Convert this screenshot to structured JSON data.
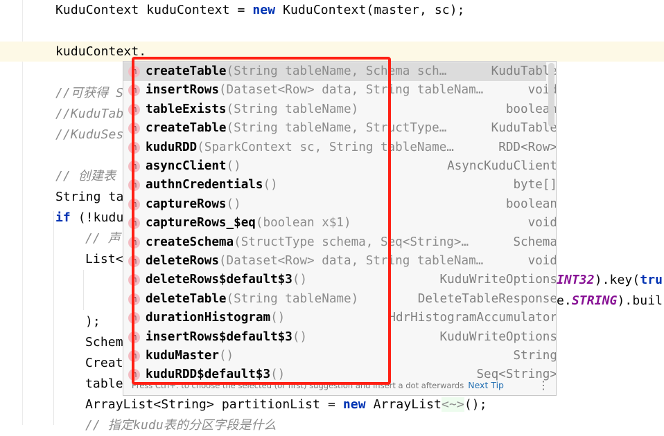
{
  "editor": {
    "lines": [
      {
        "indent": 0,
        "parts": [
          [
            "KuduContext kuduContext = ",
            ""
          ],
          [
            "new",
            "kw"
          ],
          [
            " KuduContext(master, sc);",
            ""
          ]
        ]
      },
      {
        "indent": 0,
        "parts": []
      },
      {
        "indent": 0,
        "parts": [
          [
            "kuduContext.",
            ""
          ]
        ]
      },
      {
        "indent": 0,
        "parts": []
      },
      {
        "indent": 0,
        "parts": [
          [
            "//可获得 S",
            "cm"
          ]
        ]
      },
      {
        "indent": 0,
        "parts": [
          [
            "//KuduTab",
            "cm"
          ]
        ]
      },
      {
        "indent": 0,
        "parts": [
          [
            "//KuduSes",
            "cm"
          ]
        ]
      },
      {
        "indent": 0,
        "parts": []
      },
      {
        "indent": 0,
        "parts": [
          [
            "// 创建表",
            "cm"
          ]
        ]
      },
      {
        "indent": 0,
        "parts": [
          [
            "String ta",
            ""
          ]
        ]
      },
      {
        "indent": 0,
        "parts": [
          [
            "if",
            "kw"
          ],
          [
            " (!kudu",
            ""
          ]
        ]
      },
      {
        "indent": 1,
        "parts": [
          [
            "// 声",
            "cm"
          ]
        ]
      },
      {
        "indent": 1,
        "parts": [
          [
            "List<",
            ""
          ]
        ]
      },
      {
        "indent": 2,
        "parts": []
      },
      {
        "indent": 2,
        "parts": []
      },
      {
        "indent": 1,
        "parts": [
          [
            ");",
            ""
          ]
        ]
      },
      {
        "indent": 1,
        "parts": [
          [
            "Schem",
            ""
          ]
        ]
      },
      {
        "indent": 1,
        "parts": [
          [
            "Creat",
            ""
          ]
        ]
      },
      {
        "indent": 1,
        "parts": [
          [
            "table",
            ""
          ]
        ]
      },
      {
        "indent": 1,
        "parts": [
          [
            "ArrayList<String> partitionList = ",
            ""
          ],
          [
            "new",
            "kw"
          ],
          [
            " ArrayList",
            ""
          ],
          [
            "<~>",
            "diamond"
          ],
          [
            "();",
            ""
          ]
        ]
      },
      {
        "indent": 1,
        "parts": [
          [
            "// 指定kudu表的分区字段是什么",
            "cm"
          ]
        ]
      }
    ],
    "overflow_right": [
      {
        "line": 13,
        "parts": [
          [
            "INT32",
            "const"
          ],
          [
            ").key(",
            ""
          ],
          [
            "tru",
            "kw"
          ]
        ]
      },
      {
        "line": 14,
        "parts": [
          [
            "e.",
            ""
          ],
          [
            "STRING",
            "const"
          ],
          [
            ").buil",
            ""
          ]
        ]
      }
    ]
  },
  "completion": {
    "items": [
      {
        "name": "createTable",
        "params": "(String tableName, Schema sch…",
        "ret": "KuduTable",
        "selected": true
      },
      {
        "name": "insertRows",
        "params": "(Dataset<Row> data, String tableNam…",
        "ret": "void"
      },
      {
        "name": "tableExists",
        "params": "(String tableName)",
        "ret": "boolean"
      },
      {
        "name": "createTable",
        "params": "(String tableName, StructType…",
        "ret": "KuduTable"
      },
      {
        "name": "kuduRDD",
        "params": "(SparkContext sc, String tableName…",
        "ret": "RDD<Row>"
      },
      {
        "name": "asyncClient",
        "params": "()",
        "ret": "AsyncKuduClient"
      },
      {
        "name": "authnCredentials",
        "params": "()",
        "ret": "byte[]"
      },
      {
        "name": "captureRows",
        "params": "()",
        "ret": "boolean"
      },
      {
        "name": "captureRows_$eq",
        "params": "(boolean x$1)",
        "ret": "void"
      },
      {
        "name": "createSchema",
        "params": "(StructType schema, Seq<String>…",
        "ret": "Schema"
      },
      {
        "name": "deleteRows",
        "params": "(Dataset<Row> data, String tableNam…",
        "ret": "void"
      },
      {
        "name": "deleteRows$default$3",
        "params": "()",
        "ret": "KuduWriteOptions"
      },
      {
        "name": "deleteTable",
        "params": "(String tableName)",
        "ret": "DeleteTableResponse"
      },
      {
        "name": "durationHistogram",
        "params": "()",
        "ret": "HdrHistogramAccumulator"
      },
      {
        "name": "insertRows$default$3",
        "params": "()",
        "ret": "KuduWriteOptions"
      },
      {
        "name": "kuduMaster",
        "params": "()",
        "ret": "String"
      },
      {
        "name": "kuduRDD$default$3",
        "params": "()",
        "ret": "Seq<String>"
      }
    ],
    "icon": "method-icon",
    "icon_letter": "m",
    "footer": "Press Ctrl+. to choose the selected (or first) suggestion and insert a dot afterwards",
    "next_tip": "Next Tip",
    "more_icon": "⋮"
  },
  "colors": {
    "highlight_box": "#ff2014",
    "keyword": "#0033b3",
    "comment": "#8c8c8c",
    "caret_row": "#fdf9e6"
  }
}
